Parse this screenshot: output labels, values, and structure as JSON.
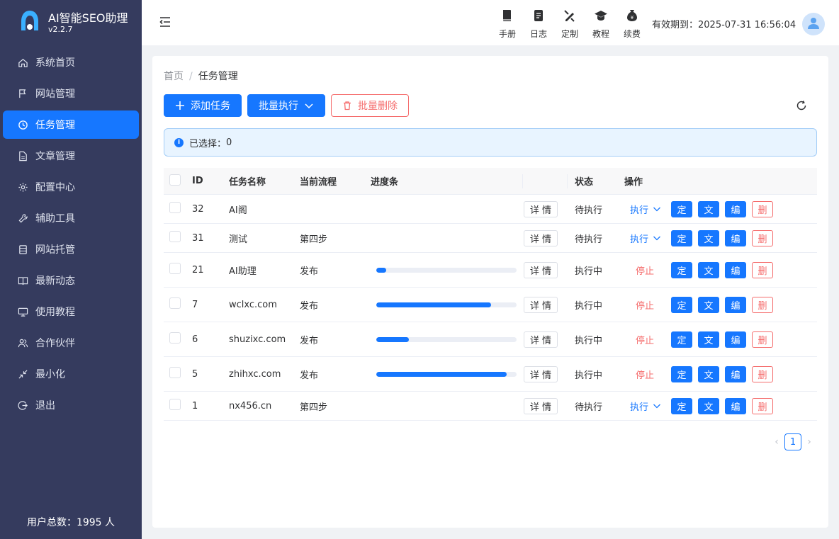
{
  "app": {
    "title": "AI智能SEO助理",
    "version": "v2.2.7"
  },
  "sidebar": {
    "items": [
      {
        "label": "系统首页",
        "icon": "home-icon"
      },
      {
        "label": "网站管理",
        "icon": "flag-icon"
      },
      {
        "label": "任务管理",
        "icon": "clock-icon",
        "active": true
      },
      {
        "label": "文章管理",
        "icon": "document-icon"
      },
      {
        "label": "配置中心",
        "icon": "gear-icon"
      },
      {
        "label": "辅助工具",
        "icon": "wrench-icon"
      },
      {
        "label": "网站托管",
        "icon": "server-icon"
      },
      {
        "label": "最新动态",
        "icon": "book-icon"
      },
      {
        "label": "使用教程",
        "icon": "monitor-icon"
      },
      {
        "label": "合作伙伴",
        "icon": "partner-icon"
      },
      {
        "label": "最小化",
        "icon": "minimize-icon"
      },
      {
        "label": "退出",
        "icon": "logout-icon"
      }
    ],
    "user_count": "用户总数：1995 人"
  },
  "header": {
    "tools": [
      {
        "label": "手册",
        "icon": "manual-icon"
      },
      {
        "label": "日志",
        "icon": "log-icon"
      },
      {
        "label": "定制",
        "icon": "customize-icon"
      },
      {
        "label": "教程",
        "icon": "graduation-cap-icon"
      },
      {
        "label": "续费",
        "icon": "money-bag-icon"
      }
    ],
    "expire_label": "有效期到：",
    "expire_value": "2025-07-31 16:56:04"
  },
  "breadcrumb": {
    "home": "首页",
    "separator": "/",
    "current": "任务管理"
  },
  "toolbar": {
    "add": "添加任务",
    "batch_exec": "批量执行",
    "batch_delete": "批量删除"
  },
  "selection": {
    "label": "已选择：",
    "count": "0"
  },
  "table": {
    "columns": {
      "id": "ID",
      "name": "任务名称",
      "flow": "当前流程",
      "progress": "进度条",
      "status": "状态",
      "ops": "操作"
    },
    "detail_label": "详 情",
    "op_labels": {
      "run": "执行",
      "stop": "停止",
      "schedule": "定",
      "article": "文",
      "edit": "编",
      "delete": "删"
    },
    "rows": [
      {
        "id": "32",
        "name": "AI阁",
        "flow": "",
        "progress": null,
        "status": "待执行",
        "running": false
      },
      {
        "id": "31",
        "name": "测试",
        "flow": "第四步",
        "progress": null,
        "status": "待执行",
        "running": false
      },
      {
        "id": "21",
        "name": "AI助理",
        "flow": "发布",
        "progress": 0.07,
        "status": "执行中",
        "running": true
      },
      {
        "id": "7",
        "name": "wclxc.com",
        "flow": "发布",
        "progress": 0.82,
        "status": "执行中",
        "running": true
      },
      {
        "id": "6",
        "name": "shuzixc.com",
        "flow": "发布",
        "progress": 0.23,
        "status": "执行中",
        "running": true
      },
      {
        "id": "5",
        "name": "zhihxc.com",
        "flow": "发布",
        "progress": 0.93,
        "status": "执行中",
        "running": true
      },
      {
        "id": "1",
        "name": "nx456.cn",
        "flow": "第四步",
        "progress": null,
        "status": "待执行",
        "running": false
      }
    ]
  },
  "pagination": {
    "current": "1"
  },
  "colors": {
    "primary": "#1677ff",
    "danger": "#f56c6c",
    "sidebar": "#353b5e"
  }
}
